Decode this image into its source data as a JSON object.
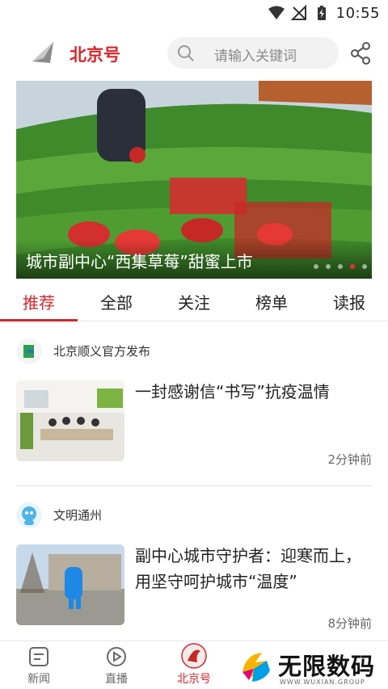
{
  "status_bar": {
    "time": "10:55"
  },
  "header": {
    "title": "北京号",
    "search_placeholder": "请输入关键词"
  },
  "banner": {
    "caption": "城市副中心“西集草莓”甜蜜上市",
    "slide_count": 5,
    "active_slide": 4
  },
  "tabs": [
    {
      "label": "推荐",
      "active": true
    },
    {
      "label": "全部"
    },
    {
      "label": "关注"
    },
    {
      "label": "榜单"
    },
    {
      "label": "读报"
    }
  ],
  "feed": [
    {
      "source": "北京顺义官方发布",
      "headline": "一封感谢信“书写”抗疫温情",
      "time": "2分钟前"
    },
    {
      "source": "文明通州",
      "headline": "副中心城市守护者：迎寒而上，用坚守呵护城市“温度”",
      "time": "8分钟前"
    }
  ],
  "bottom_nav": [
    {
      "label": "新闻"
    },
    {
      "label": "直播"
    },
    {
      "label": "北京号",
      "active": true
    }
  ],
  "watermark": {
    "text": "无限数码",
    "sub": "WWW.WUXIAN.GROUP"
  },
  "colors": {
    "accent": "#d8262b",
    "search_bg": "#f2f2f2"
  }
}
